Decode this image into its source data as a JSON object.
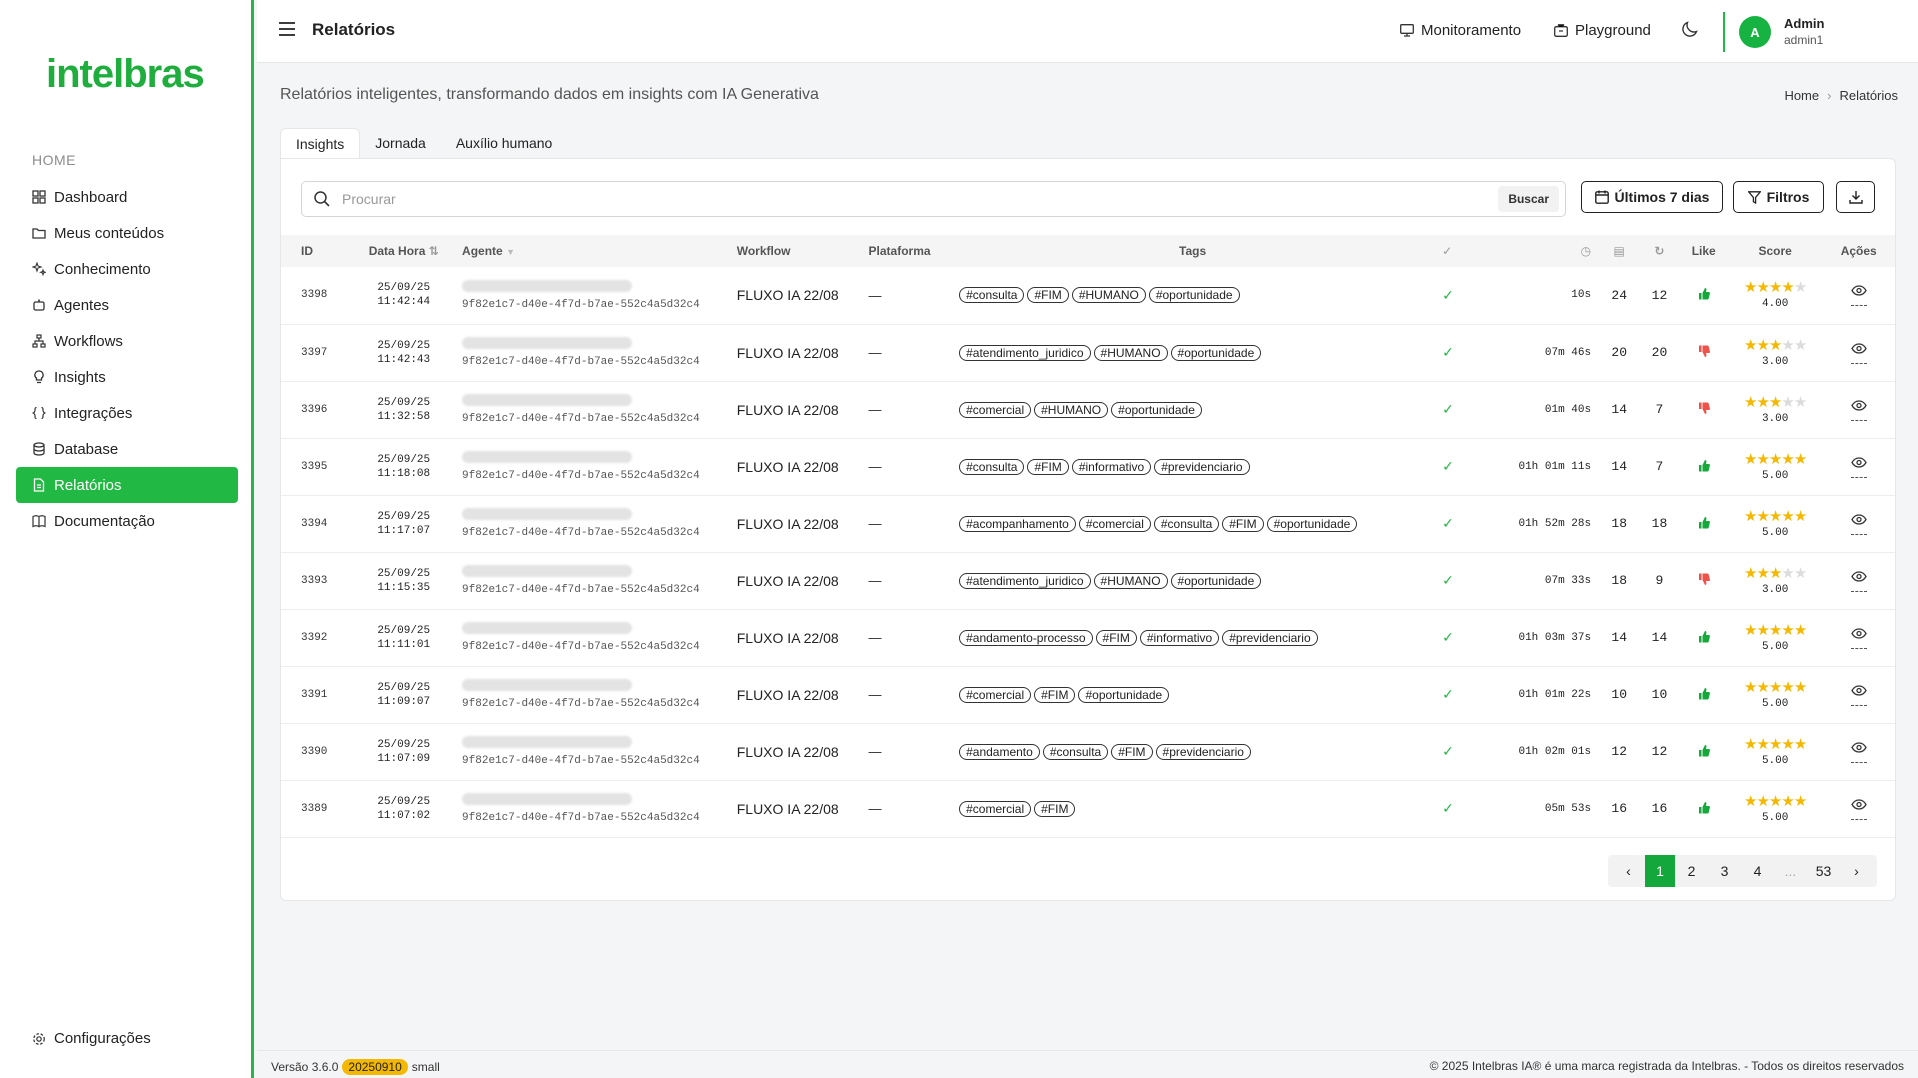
{
  "brand": {
    "logo": "intelbras",
    "accent": "#22b844"
  },
  "sidebar": {
    "section": "HOME",
    "items": [
      {
        "label": "Dashboard",
        "icon": "grid-icon"
      },
      {
        "label": "Meus conteúdos",
        "icon": "folder-icon"
      },
      {
        "label": "Conhecimento",
        "icon": "sparkle-icon"
      },
      {
        "label": "Agentes",
        "icon": "robot-icon"
      },
      {
        "label": "Workflows",
        "icon": "workflow-icon"
      },
      {
        "label": "Insights",
        "icon": "lightbulb-icon"
      },
      {
        "label": "Integrações",
        "icon": "braces-icon"
      },
      {
        "label": "Database",
        "icon": "database-icon"
      },
      {
        "label": "Relatórios",
        "icon": "report-icon",
        "active": true
      },
      {
        "label": "Documentação",
        "icon": "book-icon"
      }
    ],
    "settings": "Configurações"
  },
  "header": {
    "title": "Relatórios",
    "monitor": "Monitoramento",
    "playground": "Playground",
    "avatar": "A",
    "user_name": "Admin",
    "user_id": "admin1"
  },
  "main": {
    "subtitle": "Relatórios inteligentes, transformando dados em insights com IA Generativa",
    "breadcrumb": [
      "Home",
      "Relatórios"
    ],
    "tabs": [
      "Insights",
      "Jornada",
      "Auxílio humano"
    ],
    "search_placeholder": "Procurar",
    "search_button": "Buscar",
    "date_button": "Últimos 7 dias",
    "filter_button": "Filtros"
  },
  "table": {
    "headers": {
      "id": "ID",
      "date": "Data Hora",
      "agent": "Agente",
      "workflow": "Workflow",
      "platform": "Plataforma",
      "tags": "Tags",
      "like": "Like",
      "score": "Score",
      "actions": "Ações"
    },
    "rows": [
      {
        "id": "3398",
        "date": "25/09/25",
        "time": "11:42:44",
        "agent_id": "9f82e1c7-d40e-4f7d-b7ae-552c4a5d32c4",
        "workflow": "FLUXO IA 22/08",
        "platform": "—",
        "tags": [
          "#consulta",
          "#FIM",
          "#HUMANO",
          "#oportunidade"
        ],
        "duration": "10s",
        "messages": "24",
        "turns": "12",
        "like": "up",
        "score": "4.00",
        "stars": 4
      },
      {
        "id": "3397",
        "date": "25/09/25",
        "time": "11:42:43",
        "agent_id": "9f82e1c7-d40e-4f7d-b7ae-552c4a5d32c4",
        "workflow": "FLUXO IA 22/08",
        "platform": "—",
        "tags": [
          "#atendimento_juridico",
          "#HUMANO",
          "#oportunidade"
        ],
        "duration": "07m 46s",
        "messages": "20",
        "turns": "20",
        "like": "down",
        "score": "3.00",
        "stars": 3
      },
      {
        "id": "3396",
        "date": "25/09/25",
        "time": "11:32:58",
        "agent_id": "9f82e1c7-d40e-4f7d-b7ae-552c4a5d32c4",
        "workflow": "FLUXO IA 22/08",
        "platform": "—",
        "tags": [
          "#comercial",
          "#HUMANO",
          "#oportunidade"
        ],
        "duration": "01m 40s",
        "messages": "14",
        "turns": "7",
        "like": "down",
        "score": "3.00",
        "stars": 3
      },
      {
        "id": "3395",
        "date": "25/09/25",
        "time": "11:18:08",
        "agent_id": "9f82e1c7-d40e-4f7d-b7ae-552c4a5d32c4",
        "workflow": "FLUXO IA 22/08",
        "platform": "—",
        "tags": [
          "#consulta",
          "#FIM",
          "#informativo",
          "#previdenciario"
        ],
        "duration": "01h 01m 11s",
        "messages": "14",
        "turns": "7",
        "like": "up",
        "score": "5.00",
        "stars": 5
      },
      {
        "id": "3394",
        "date": "25/09/25",
        "time": "11:17:07",
        "agent_id": "9f82e1c7-d40e-4f7d-b7ae-552c4a5d32c4",
        "workflow": "FLUXO IA 22/08",
        "platform": "—",
        "tags": [
          "#acompanhamento",
          "#comercial",
          "#consulta",
          "#FIM",
          "#oportunidade"
        ],
        "duration": "01h 52m 28s",
        "messages": "18",
        "turns": "18",
        "like": "up",
        "score": "5.00",
        "stars": 5
      },
      {
        "id": "3393",
        "date": "25/09/25",
        "time": "11:15:35",
        "agent_id": "9f82e1c7-d40e-4f7d-b7ae-552c4a5d32c4",
        "workflow": "FLUXO IA 22/08",
        "platform": "—",
        "tags": [
          "#atendimento_juridico",
          "#HUMANO",
          "#oportunidade"
        ],
        "duration": "07m 33s",
        "messages": "18",
        "turns": "9",
        "like": "down",
        "score": "3.00",
        "stars": 3
      },
      {
        "id": "3392",
        "date": "25/09/25",
        "time": "11:11:01",
        "agent_id": "9f82e1c7-d40e-4f7d-b7ae-552c4a5d32c4",
        "workflow": "FLUXO IA 22/08",
        "platform": "—",
        "tags": [
          "#andamento-processo",
          "#FIM",
          "#informativo",
          "#previdenciario"
        ],
        "duration": "01h 03m 37s",
        "messages": "14",
        "turns": "14",
        "like": "up",
        "score": "5.00",
        "stars": 5
      },
      {
        "id": "3391",
        "date": "25/09/25",
        "time": "11:09:07",
        "agent_id": "9f82e1c7-d40e-4f7d-b7ae-552c4a5d32c4",
        "workflow": "FLUXO IA 22/08",
        "platform": "—",
        "tags": [
          "#comercial",
          "#FIM",
          "#oportunidade"
        ],
        "duration": "01h 01m 22s",
        "messages": "10",
        "turns": "10",
        "like": "up",
        "score": "5.00",
        "stars": 5
      },
      {
        "id": "3390",
        "date": "25/09/25",
        "time": "11:07:09",
        "agent_id": "9f82e1c7-d40e-4f7d-b7ae-552c4a5d32c4",
        "workflow": "FLUXO IA 22/08",
        "platform": "—",
        "tags": [
          "#andamento",
          "#consulta",
          "#FIM",
          "#previdenciario"
        ],
        "duration": "01h 02m 01s",
        "messages": "12",
        "turns": "12",
        "like": "up",
        "score": "5.00",
        "stars": 5
      },
      {
        "id": "3389",
        "date": "25/09/25",
        "time": "11:07:02",
        "agent_id": "9f82e1c7-d40e-4f7d-b7ae-552c4a5d32c4",
        "workflow": "FLUXO IA 22/08",
        "platform": "—",
        "tags": [
          "#comercial",
          "#FIM"
        ],
        "duration": "05m 53s",
        "messages": "16",
        "turns": "16",
        "like": "up",
        "score": "5.00",
        "stars": 5
      }
    ]
  },
  "pagination": {
    "pages": [
      "1",
      "2",
      "3",
      "4"
    ],
    "ellipsis": "...",
    "last": "53",
    "current": "1"
  },
  "footer": {
    "version": "Versão 3.6.0",
    "build": "20250910",
    "size": "small",
    "copyright": "© 2025 Intelbras IA® é uma marca registrada da Intelbras. - Todos os direitos reservados"
  }
}
